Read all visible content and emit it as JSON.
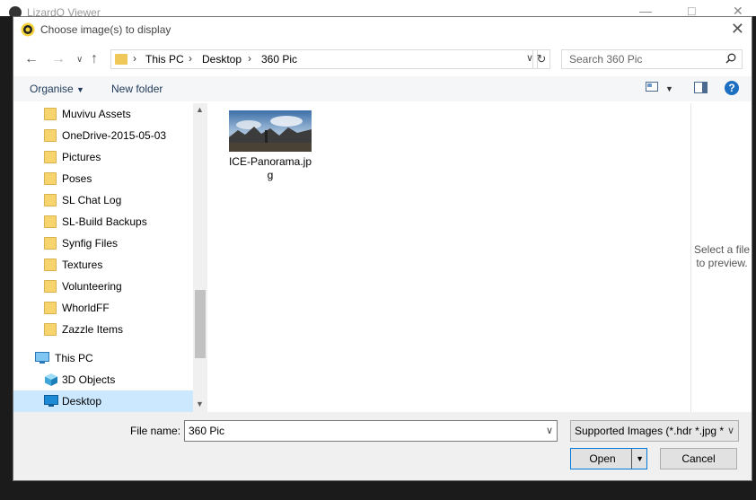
{
  "background_window": {
    "title": "LizardQ Viewer"
  },
  "dialog": {
    "title": "Choose image(s) to display"
  },
  "address": {
    "crumbs": [
      "This PC",
      "Desktop",
      "360 Pic"
    ]
  },
  "search": {
    "placeholder": "Search 360 Pic"
  },
  "commands": {
    "organise": "Organise",
    "new_folder": "New folder"
  },
  "sidebar": {
    "items": [
      {
        "label": "Muvivu Assets",
        "icon": "folder-icon"
      },
      {
        "label": "OneDrive-2015-05-03",
        "icon": "folder-icon"
      },
      {
        "label": "Pictures",
        "icon": "folder-icon"
      },
      {
        "label": "Poses",
        "icon": "folder-icon"
      },
      {
        "label": "SL Chat Log",
        "icon": "folder-icon"
      },
      {
        "label": "SL-Build Backups",
        "icon": "folder-icon"
      },
      {
        "label": "Synfig Files",
        "icon": "folder-icon"
      },
      {
        "label": "Textures",
        "icon": "folder-icon"
      },
      {
        "label": "Volunteering",
        "icon": "folder-icon"
      },
      {
        "label": "WhorldFF",
        "icon": "folder-icon"
      },
      {
        "label": "Zazzle Items",
        "icon": "folder-icon"
      },
      {
        "label": "This PC",
        "icon": "computer-icon"
      },
      {
        "label": "3D Objects",
        "icon": "cube-icon"
      },
      {
        "label": "Desktop",
        "icon": "desktop-icon",
        "selected": true
      }
    ]
  },
  "files": [
    {
      "name": "ICE-Panorama.jpg"
    }
  ],
  "preview": {
    "text": "Select a file to preview."
  },
  "footer": {
    "filename_label": "File name:",
    "filename_value": "360 Pic",
    "filetype_value": "Supported Images (*.hdr *.jpg *",
    "open_label": "Open",
    "cancel_label": "Cancel"
  },
  "colors": {
    "accent": "#0078d7",
    "selected_bg": "#cce8ff",
    "folder": "#f7d46d"
  }
}
